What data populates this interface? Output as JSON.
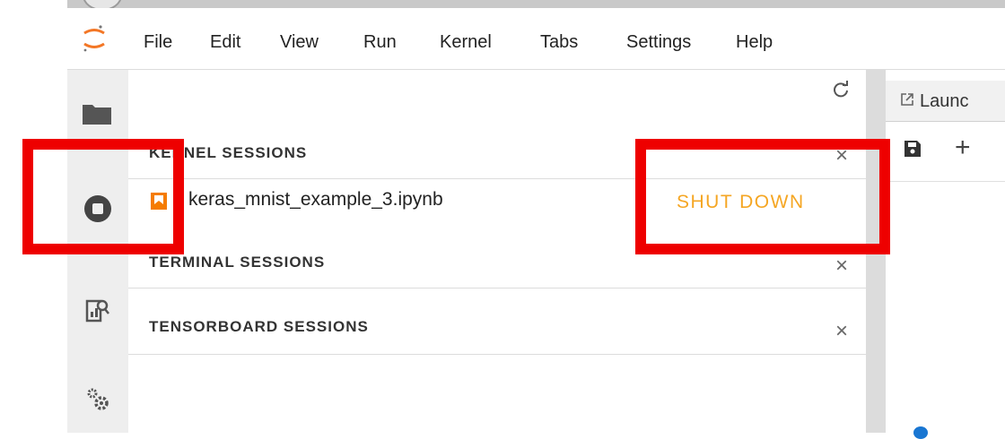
{
  "menubar": {
    "logo_icon": "jupyter-logo",
    "items": [
      "File",
      "Edit",
      "View",
      "Run",
      "Kernel",
      "Tabs",
      "Settings",
      "Help"
    ]
  },
  "leftbar": {
    "icons": [
      "folder-icon",
      "running-sessions-icon",
      "tensorboard-icon",
      "settings-gears-icon"
    ]
  },
  "panel": {
    "refresh_icon": "refresh-icon",
    "sections": {
      "kernel": {
        "title": "KERNEL SESSIONS",
        "session": {
          "name": "keras_mnist_example_3.ipynb",
          "action": "SHUT DOWN"
        }
      },
      "terminal": {
        "title": "TERMINAL SESSIONS"
      },
      "tensorboard": {
        "title": "TENSORBOARD SESSIONS"
      }
    },
    "close_glyph": "×"
  },
  "rightpanel": {
    "tab_label": "Launc",
    "toolbar": {
      "plus": "+"
    }
  },
  "colors": {
    "accent_orange": "#f5a623",
    "annotation_red": "#ee0000",
    "sidebar_bg": "#eeeeee"
  }
}
